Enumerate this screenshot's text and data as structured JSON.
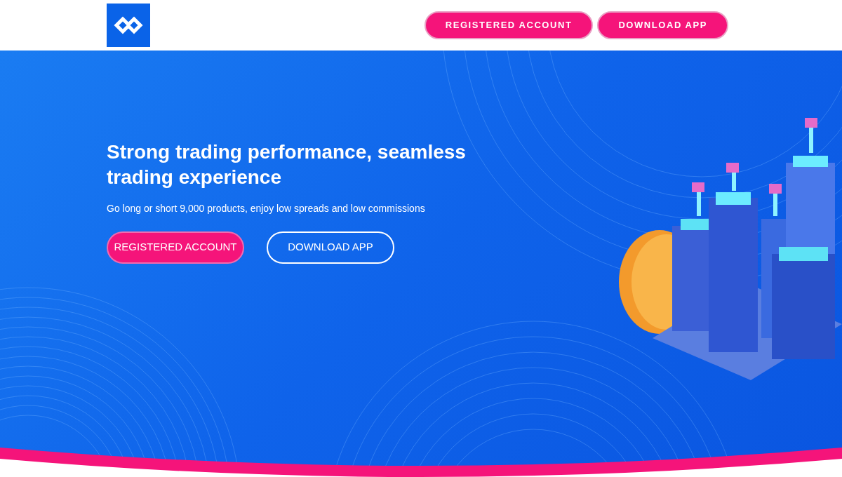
{
  "header": {
    "buttons": [
      {
        "label": "REGISTERED ACCOUNT",
        "kind": "filled"
      },
      {
        "label": "DOWNLOAD APP",
        "kind": "filled"
      }
    ]
  },
  "hero": {
    "title": "Strong trading performance, seamless trading experience",
    "subtitle": "Go long or short 9,000 products, enjoy low spreads and low commissions",
    "buttons": [
      {
        "label": "REGISTERED ACCOUNT",
        "kind": "filled"
      },
      {
        "label": "DOWNLOAD APP",
        "kind": "outline"
      }
    ]
  }
}
